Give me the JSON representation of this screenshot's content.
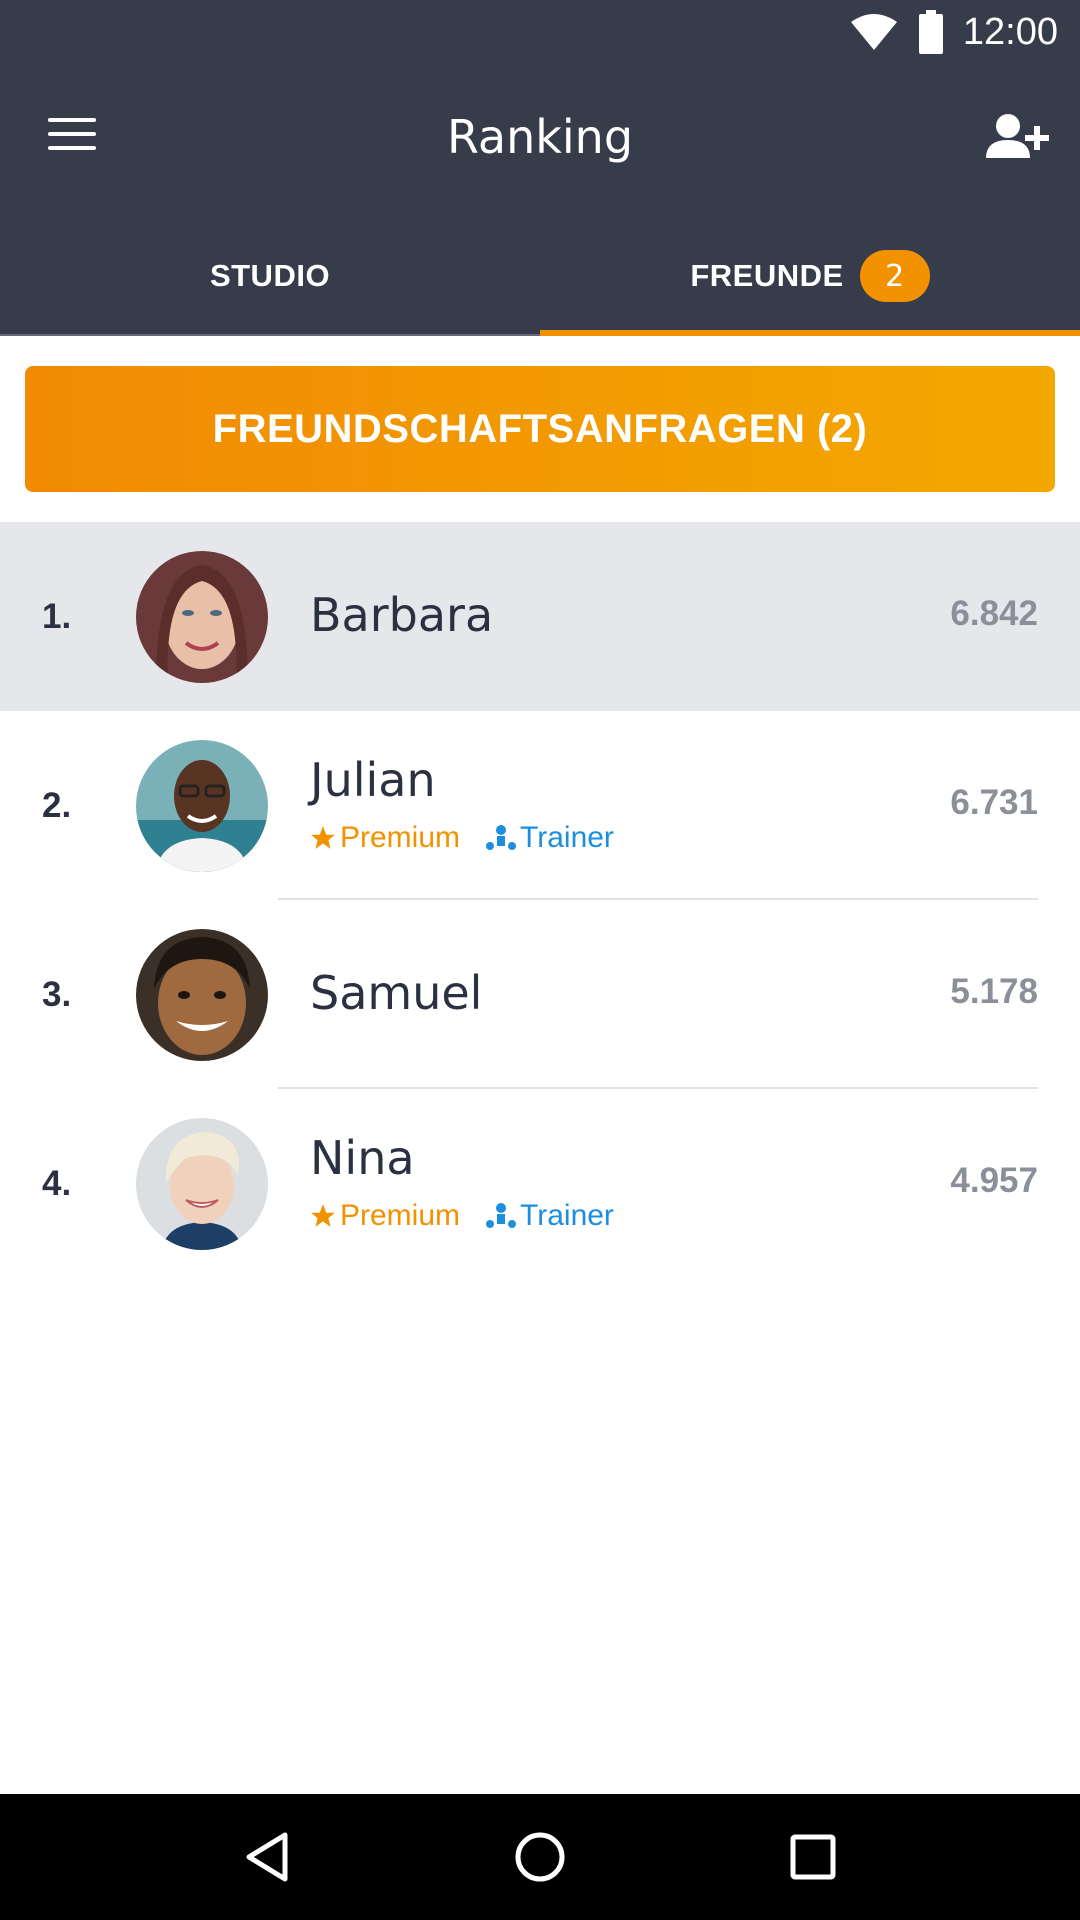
{
  "status_bar": {
    "time": "12:00",
    "icons": [
      "wifi-icon",
      "battery-icon"
    ]
  },
  "app_bar": {
    "title": "Ranking",
    "menu_icon": "menu-icon",
    "action_icon": "add-friend-icon"
  },
  "tabs": [
    {
      "label": "STUDIO",
      "selected": false
    },
    {
      "label": "FREUNDE",
      "badge": "2",
      "selected": true
    }
  ],
  "friend_requests_button": {
    "label": "FREUNDSCHAFTSANFRAGEN (2)"
  },
  "ranking": [
    {
      "rank": "1.",
      "name": "Barbara",
      "score": "6.842",
      "highlighted": true,
      "premium": null,
      "trainer": null
    },
    {
      "rank": "2.",
      "name": "Julian",
      "score": "6.731",
      "highlighted": false,
      "premium": "Premium",
      "trainer": "Trainer"
    },
    {
      "rank": "3.",
      "name": "Samuel",
      "score": "5.178",
      "highlighted": false,
      "premium": null,
      "trainer": null
    },
    {
      "rank": "4.",
      "name": "Nina",
      "score": "4.957",
      "highlighted": false,
      "premium": "Premium",
      "trainer": "Trainer"
    }
  ],
  "colors": {
    "header": "#373c4b",
    "accent": "#f39200",
    "trainer": "#1c8ee0",
    "score": "#8b8f99",
    "highlight_row": "#e6e7ea"
  },
  "nav_bar": {
    "icons": [
      "back-icon",
      "home-icon",
      "recents-icon"
    ]
  }
}
